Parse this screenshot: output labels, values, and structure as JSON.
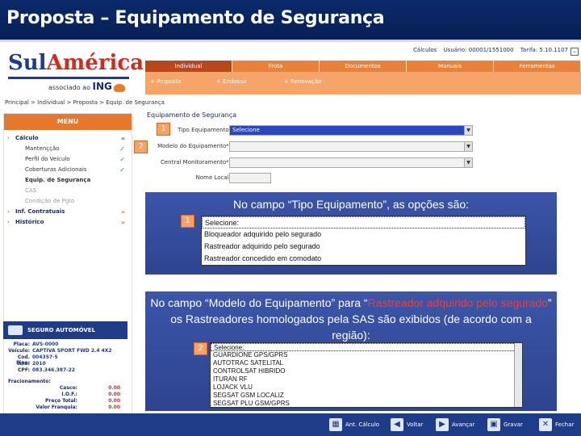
{
  "slide_title": "Proposta – Equipamento de Segurança",
  "logo": {
    "brand_a": "Sul",
    "brand_b": "América",
    "sub_text": "associado ao",
    "partner": "ING"
  },
  "topbar": {
    "calculos": "Cálculos",
    "usuario": "Usuário: 00001/1551000",
    "tarifa": "Tarifa: 5.10.1107",
    "close": "–"
  },
  "nav_tabs": [
    "Individual",
    "Frota",
    "Documentos",
    "Manuais",
    "Ferramentas"
  ],
  "subnav": [
    "+ Proposta",
    "+ Endosso",
    "+ Renovação"
  ],
  "breadcrumb": "Principal > Individual > Proposta > Equip. de Segurança",
  "menu": {
    "header": "MENU",
    "items": [
      {
        "label": "Cálculo",
        "type": "group",
        "mark": "«"
      },
      {
        "label": "Mantençção",
        "type": "sub",
        "mark": "✓"
      },
      {
        "label": "Perfil do Veículo",
        "type": "sub",
        "mark": "✓"
      },
      {
        "label": "Coberturas Adicionais",
        "type": "sub",
        "mark": "✓"
      },
      {
        "label": "Equip. de Segurança",
        "type": "sub-bold",
        "mark": ""
      },
      {
        "label": "CAS",
        "type": "sub",
        "mark": ""
      },
      {
        "label": "Condição de Pgto",
        "type": "sub",
        "mark": ""
      },
      {
        "label": "Inf. Contratuais",
        "type": "group",
        "mark": "»"
      },
      {
        "label": "Histórico",
        "type": "group",
        "mark": "»"
      }
    ]
  },
  "seguro": {
    "label": "SEGURO AUTOMÓVEL"
  },
  "vehicle": [
    {
      "k": "Placa:",
      "v": "AVS-0000"
    },
    {
      "k": "Veículo:",
      "v": "CAPTIVA SPORT FWD 2.4 4X2"
    },
    {
      "k": "Cod. Fipe:",
      "v": "004357-5"
    },
    {
      "k": "Ano:",
      "v": "2010"
    },
    {
      "k": "CPF:",
      "v": "083.346.387-22"
    }
  ],
  "prices": [
    {
      "k": "Fracionamento:",
      "v": ""
    },
    {
      "k": "Casco:",
      "v": "0.00"
    },
    {
      "k": "I.O.F.:",
      "v": "0.00"
    },
    {
      "k": "Preço Total:",
      "v": "0.00"
    },
    {
      "k": "Valor Franquia:",
      "v": "0.00"
    }
  ],
  "form": {
    "title": "Equipamento de Segurança",
    "rows": [
      {
        "label": "Tipo Equipamento:",
        "value": "Selecione"
      },
      {
        "label": "Modelo do Equipamento*:",
        "value": ""
      },
      {
        "label": "Central Monitoramento*:",
        "value": ""
      },
      {
        "label": "Nome Local:",
        "value": ""
      }
    ]
  },
  "badges": {
    "one": "1",
    "two": "2"
  },
  "callout1": {
    "text": "No campo “Tipo Equipamento”, as opções são:",
    "options": [
      "Selecione:",
      "Bloqueador adquirido pelo segurado",
      "Rastreador adquirido pelo segurado",
      "Rastreador concedido em comodato"
    ]
  },
  "callout2": {
    "text_a": "No campo “Modelo do Equipamento” para “",
    "text_red": "Rastreador adquirido pelo segurado",
    "text_b": "” os Rastreadores homologados pela SAS são exibidos (de acordo com a região):",
    "options": [
      "Selecione:",
      "GUARDIONE GPS/GPRS",
      "AUTOTRAC SATELITAL",
      "CONTROLSAT HIBRIDO",
      "ITURAN RF",
      "LOJACK VLU",
      "SEGSAT GSM LOCALIZ",
      "SEGSAT PLU GSM/GPRS"
    ]
  },
  "bottom": {
    "buttons": [
      "Ant. Cálculo",
      "Voltar",
      "Avançar",
      "Gravar",
      "Fechar"
    ]
  },
  "colors": {
    "navy": "#1f3c88",
    "orange": "#e6772c",
    "callout": "#3b55a8",
    "red": "#ff3a2a"
  }
}
